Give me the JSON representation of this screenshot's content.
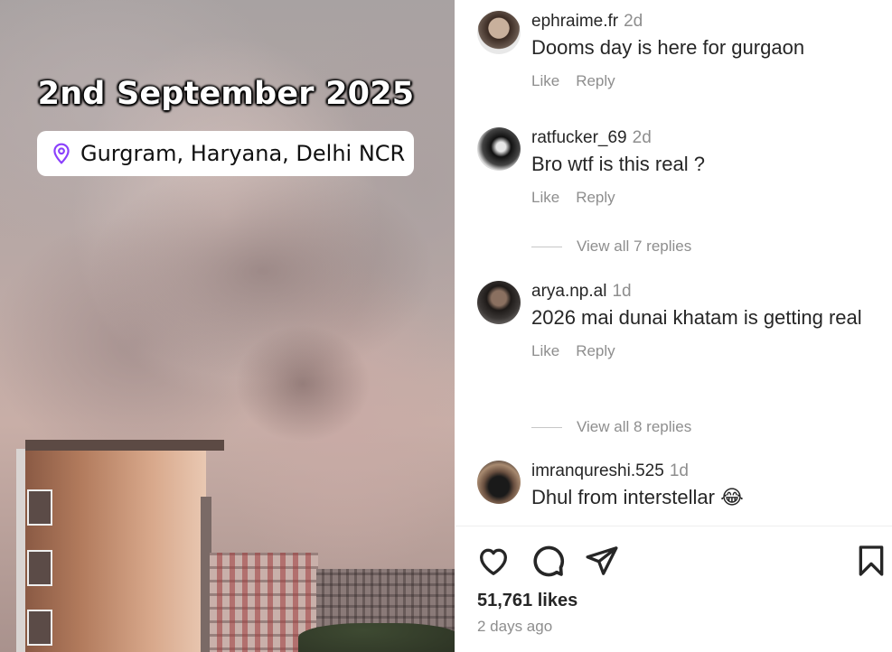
{
  "media": {
    "overlay_date": "2nd September 2025",
    "location": "Gurgram, Haryana, Delhi NCR"
  },
  "comments": [
    {
      "username": "ephraime.fr",
      "time": "2d",
      "text": "Dooms day is here for gurgaon",
      "like_label": "Like",
      "reply_label": "Reply"
    },
    {
      "username": "ratfucker_69",
      "time": "2d",
      "text": "Bro wtf is this real ?",
      "like_label": "Like",
      "reply_label": "Reply",
      "view_replies": "View all 7 replies"
    },
    {
      "username": "arya.np.al",
      "time": "1d",
      "text": "2026 mai dunai khatam is getting real",
      "like_label": "Like",
      "reply_label": "Reply",
      "view_replies": "View all 8 replies"
    },
    {
      "username": "imranqureshi.525",
      "time": "1d",
      "text": "Dhul from interstellar 😂"
    }
  ],
  "post": {
    "likes": "51,761 likes",
    "posted": "2 days ago"
  },
  "icons": {
    "like": "heart-icon",
    "comment": "comment-bubble-icon",
    "share": "paper-plane-icon",
    "save": "bookmark-icon",
    "location": "location-pin-icon"
  },
  "colors": {
    "text": "#262626",
    "secondary": "#8e8e8e",
    "location_pin": "#8a3ffc"
  }
}
